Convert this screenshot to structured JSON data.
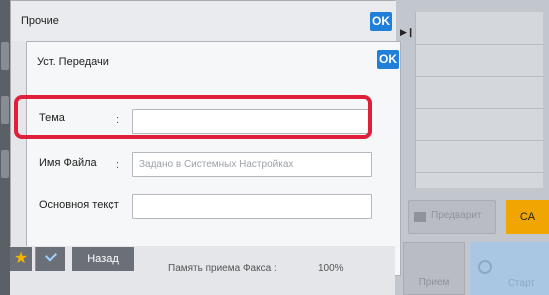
{
  "outer_dialog": {
    "title": "Прочие",
    "ok_label": "OK"
  },
  "inner_dialog": {
    "title": "Уст. Передачи",
    "ok_label": "OK"
  },
  "fields": {
    "subject": {
      "label": "Тема",
      "colon": ":",
      "value": "",
      "placeholder": ""
    },
    "file_name": {
      "label": "Имя Файла",
      "colon": ":",
      "value": "",
      "placeholder": "Задано в Системных Настройках"
    },
    "body_text": {
      "label": "Основноя текст",
      "colon": ":",
      "value": "",
      "placeholder": ""
    }
  },
  "background": {
    "preview_label": "Предварит",
    "ca_label": "CA",
    "receive_label": "Прием",
    "start_label": "Старт"
  },
  "bottom_bar": {
    "back_label": "Назад",
    "status_text": "Память приема Факса :",
    "status_value": "100%"
  },
  "colors": {
    "highlight": "#e0203a",
    "ok_button": "#1f7fd9",
    "ca_button": "#f0a500",
    "star": "#f5b300"
  },
  "icons": {
    "play": "play-arrow-icon",
    "star": "star-icon",
    "check": "check-icon"
  }
}
